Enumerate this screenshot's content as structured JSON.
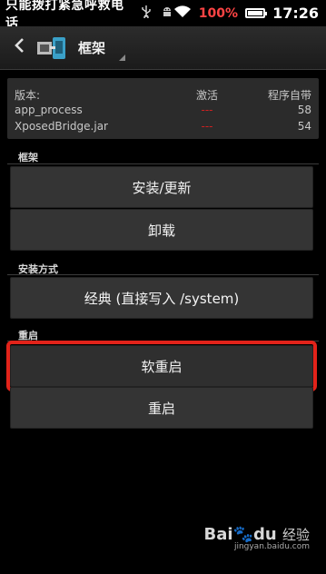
{
  "status_bar": {
    "notification_text": "只能拨打紧急呼救电话",
    "battery_percent": "100%",
    "battery_level": 1.0,
    "time": "17:26",
    "icons": [
      "usb-icon",
      "android-debug-icon",
      "wifi-icon",
      "battery-icon"
    ]
  },
  "action_bar": {
    "title": "框架",
    "back_icon": "chevron-left-icon",
    "app_icon": "xposed-app-icon"
  },
  "version_table": {
    "headers": [
      "版本:",
      "激活",
      "程序自带"
    ],
    "rows": [
      {
        "name": "app_process",
        "active": "---",
        "bundled": "58"
      },
      {
        "name": "XposedBridge.jar",
        "active": "---",
        "bundled": "54"
      }
    ]
  },
  "sections": {
    "framework": {
      "label": "框架",
      "install_update": "安装/更新",
      "uninstall": "卸载"
    },
    "install_method": {
      "label": "安装方式",
      "value": "经典 (直接写入 /system)"
    },
    "reboot": {
      "label": "重启",
      "soft_reboot": "软重启",
      "reboot": "重启"
    }
  },
  "watermark": {
    "logo_bai": "Bai",
    "logo_du": "du",
    "logo_suffix": "经验",
    "url": "jingyan.baidu.com"
  },
  "colors": {
    "highlight_border": "#e2231a",
    "battery_text": "#ff4444",
    "dash": "#d02020"
  }
}
